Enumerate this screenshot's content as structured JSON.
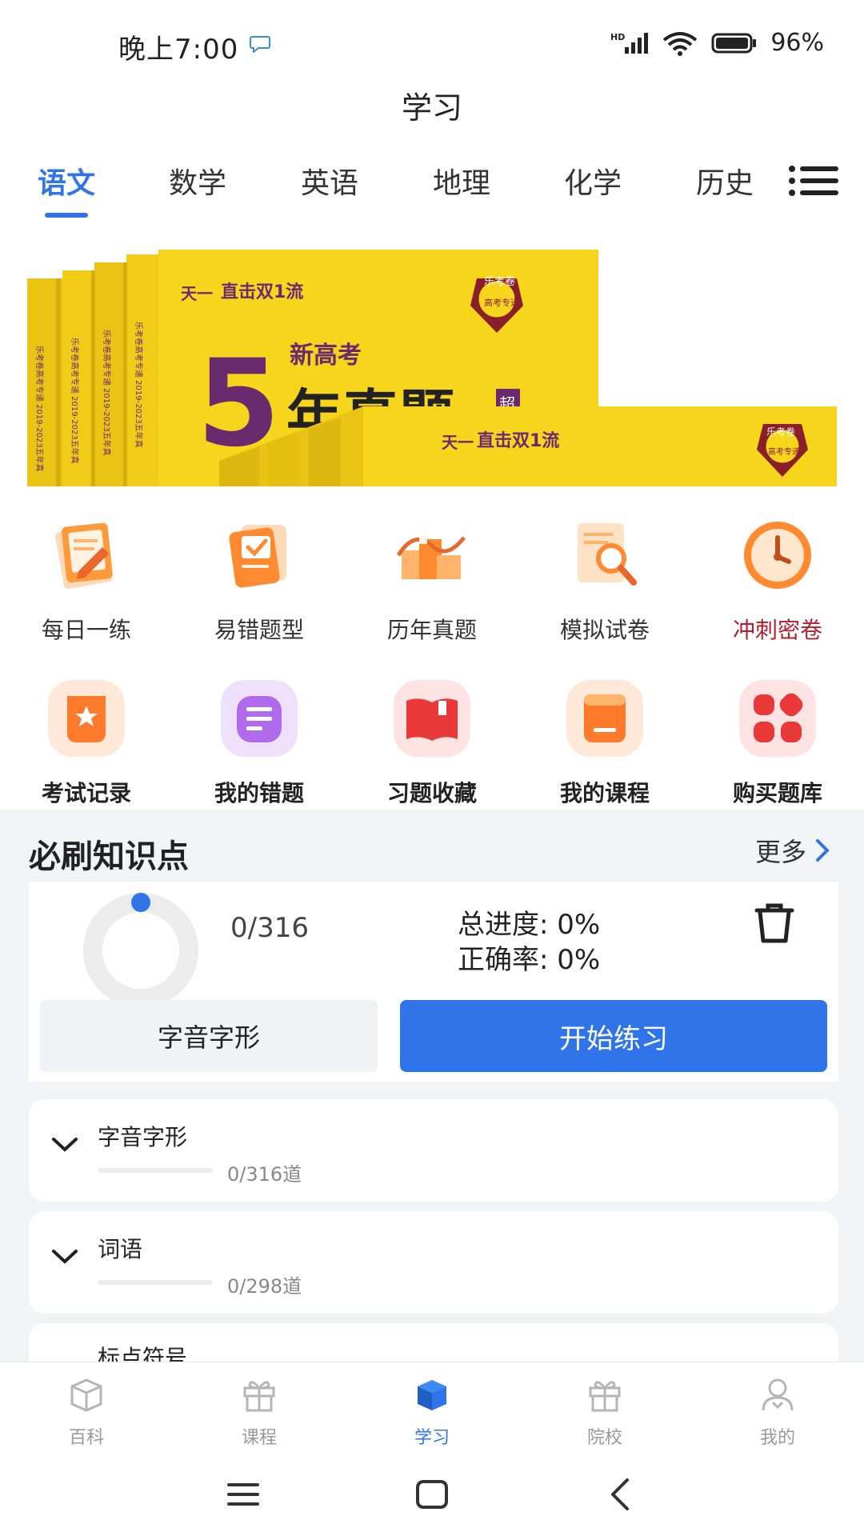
{
  "status_bar": {
    "time": "晚上7:00",
    "signal": "HD",
    "battery": "96%"
  },
  "page": {
    "title": "学习"
  },
  "tabs": [
    {
      "label": "语文",
      "active": true
    },
    {
      "label": "数学",
      "active": false
    },
    {
      "label": "英语",
      "active": false
    },
    {
      "label": "地理",
      "active": false
    },
    {
      "label": "化学",
      "active": false
    },
    {
      "label": "历史",
      "active": false
    }
  ],
  "banner": {
    "brand": "直击双1流",
    "headline_number": "5",
    "headline_prefix": "新高考",
    "headline_text": "年真题",
    "badge": "超",
    "seal_text": "乐考卷",
    "seal_sub": "高考专递",
    "spine_text": "乐考卷高考专递 2019-2023五年真",
    "publisher": "天一"
  },
  "quick_actions_row1": [
    {
      "label": "每日一练",
      "icon": "daily-practice-icon"
    },
    {
      "label": "易错题型",
      "icon": "error-prone-icon"
    },
    {
      "label": "历年真题",
      "icon": "past-exams-icon"
    },
    {
      "label": "模拟试卷",
      "icon": "mock-exam-icon"
    },
    {
      "label": "冲刺密卷",
      "icon": "sprint-clock-icon"
    }
  ],
  "quick_actions_row2": [
    {
      "label": "考试记录",
      "icon": "exam-record-icon"
    },
    {
      "label": "我的错题",
      "icon": "my-mistakes-icon"
    },
    {
      "label": "习题收藏",
      "icon": "favorites-book-icon"
    },
    {
      "label": "我的课程",
      "icon": "my-courses-icon"
    },
    {
      "label": "购买题库",
      "icon": "buy-bank-icon"
    }
  ],
  "section": {
    "title": "必刷知识点",
    "more": "更多",
    "done": "0/316",
    "total_progress": "总进度: 0%",
    "accuracy": "正确率: 0%",
    "current_topic": "字音字形",
    "start_button": "开始练习",
    "progress_fraction": 0
  },
  "topics": [
    {
      "name": "字音字形",
      "count": "0/316道",
      "progress": 0
    },
    {
      "name": "词语",
      "count": "0/298道",
      "progress": 0
    },
    {
      "name": "标点符号",
      "count": "",
      "progress": 0
    }
  ],
  "bottom_nav": [
    {
      "label": "百科",
      "icon": "encyclopedia-box-icon",
      "active": false
    },
    {
      "label": "课程",
      "icon": "course-gift-icon",
      "active": false
    },
    {
      "label": "学习",
      "icon": "study-cube-icon",
      "active": true
    },
    {
      "label": "院校",
      "icon": "school-gift-icon",
      "active": false
    },
    {
      "label": "我的",
      "icon": "profile-icon",
      "active": false
    }
  ],
  "colors": {
    "accent": "#2f74e8",
    "banner_yellow": "#f7d51d",
    "banner_purple": "#6a2b6e",
    "highlight_red": "#b0202e"
  }
}
